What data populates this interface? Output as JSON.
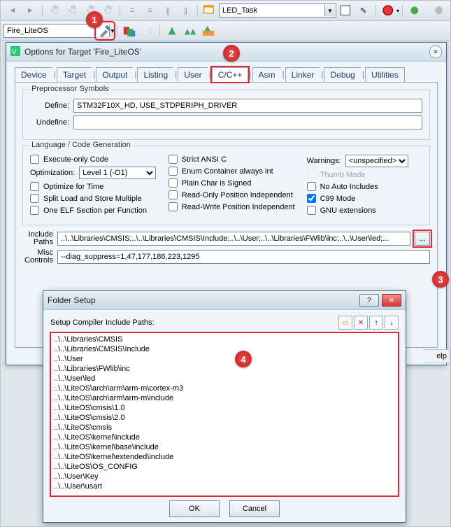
{
  "toolbar2": {
    "project_combo": "Fire_LiteOS",
    "top_combo": "LED_Task"
  },
  "options": {
    "title": "Options for Target 'Fire_LiteOS'",
    "tabs": [
      "Device",
      "Target",
      "Output",
      "Listing",
      "User",
      "C/C++",
      "Asm",
      "Linker",
      "Debug",
      "Utilities"
    ],
    "active_tab": "C/C++",
    "preprocessor": {
      "legend": "Preprocessor Symbols",
      "define_label": "Define:",
      "define_value": "STM32F10X_HD, USE_STDPERIPH_DRIVER",
      "undefine_label": "Undefine:",
      "undefine_value": ""
    },
    "langgen": {
      "legend": "Language / Code Generation",
      "execute_only": "Execute-only Code",
      "optimization_lbl": "Optimization:",
      "optimization_val": "Level 1 (-O1)",
      "optimize_time": "Optimize for Time",
      "split_load": "Split Load and Store Multiple",
      "one_elf": "One ELF Section per Function",
      "strict_ansi": "Strict ANSI C",
      "enum_int": "Enum Container always int",
      "plain_char": "Plain Char is Signed",
      "ro_pi": "Read-Only Position Independent",
      "rw_pi": "Read-Write Position Independent",
      "warnings_lbl": "Warnings:",
      "warnings_val": "<unspecified>",
      "thumb": "Thumb Mode",
      "no_auto_inc": "No Auto Includes",
      "c99": "C99 Mode",
      "gnu_ext": "GNU extensions"
    },
    "include": {
      "label": "Include\nPaths",
      "value": "..\\..\\Libraries\\CMSIS;..\\..\\Libraries\\CMSIS\\Include;..\\..\\User;..\\..\\Libraries\\FWlib\\inc;..\\..\\User\\led;..."
    },
    "misc": {
      "label": "Misc\nControls",
      "value": "--diag_suppress=1,47,177,186,223,1295"
    }
  },
  "folder": {
    "title": "Folder Setup",
    "label": "Setup Compiler Include Paths:",
    "paths": [
      "..\\..\\Libraries\\CMSIS",
      "..\\..\\Libraries\\CMSIS\\Include",
      "..\\..\\User",
      "..\\..\\Libraries\\FWlib\\inc",
      "..\\..\\User\\led",
      "..\\..\\LiteOS\\arch\\arm\\arm-m\\cortex-m3",
      "..\\..\\LiteOS\\arch\\arm\\arm-m\\include",
      "..\\..\\LiteOS\\cmsis\\1.0",
      "..\\..\\LiteOS\\cmsis\\2.0",
      "..\\..\\LiteOS\\cmsis",
      "..\\..\\LiteOS\\kernel\\include",
      "..\\..\\LiteOS\\kernel\\base\\include",
      "..\\..\\LiteOS\\kernel\\extended\\include",
      "..\\..\\LiteOS\\OS_CONFIG",
      "..\\..\\User\\Key",
      "..\\..\\User\\usart"
    ],
    "ok": "OK",
    "cancel": "Cancel"
  },
  "help_fragment": "elp",
  "callouts": {
    "c1": "1",
    "c2": "2",
    "c3": "3",
    "c4": "4"
  }
}
